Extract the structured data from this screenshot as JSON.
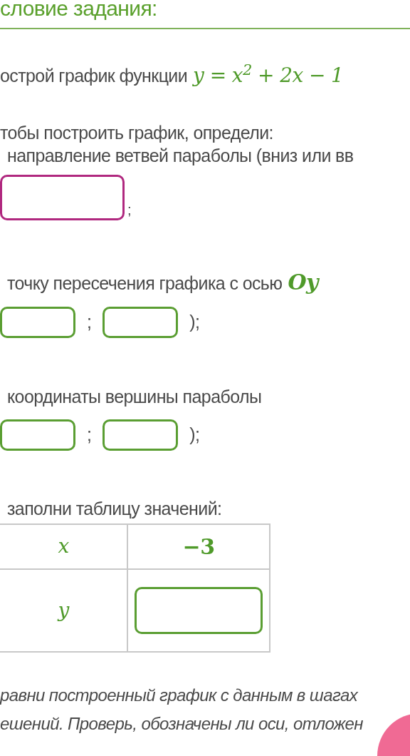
{
  "heading": "словие задания:",
  "task": {
    "text": "острой график функции",
    "formula": "y = x$^{2}$ + 2x − 1"
  },
  "intro": "тобы построить график, определи:",
  "steps": [
    {
      "kind": "direction",
      "label": "направление ветвей параболы (вниз или вв",
      "fields": [
        {
          "focused": true
        }
      ],
      "suffix": ";"
    },
    {
      "kind": "point",
      "label": "точку пересечения графика с осью",
      "label_math": "Oy",
      "fields": [
        {
          "focused": false
        },
        {
          "focused": false
        }
      ],
      "separator": ";",
      "suffix": ");"
    },
    {
      "kind": "point",
      "label": "координаты вершины параболы",
      "fields": [
        {
          "focused": false
        },
        {
          "focused": false
        }
      ],
      "separator": ";",
      "suffix": ");"
    },
    {
      "kind": "table",
      "label": "заполни таблицу значений:",
      "rows": [
        {
          "header": "x",
          "cells": [
            {
              "kind": "text",
              "text": "−3"
            }
          ]
        },
        {
          "header": "y",
          "cells": [
            {
              "kind": "input",
              "focused": false
            }
          ]
        }
      ]
    }
  ],
  "note": [
    "равни построенный график с данным в шагах",
    "ешений. Проверь, обозначены ли оси, отложен"
  ]
}
